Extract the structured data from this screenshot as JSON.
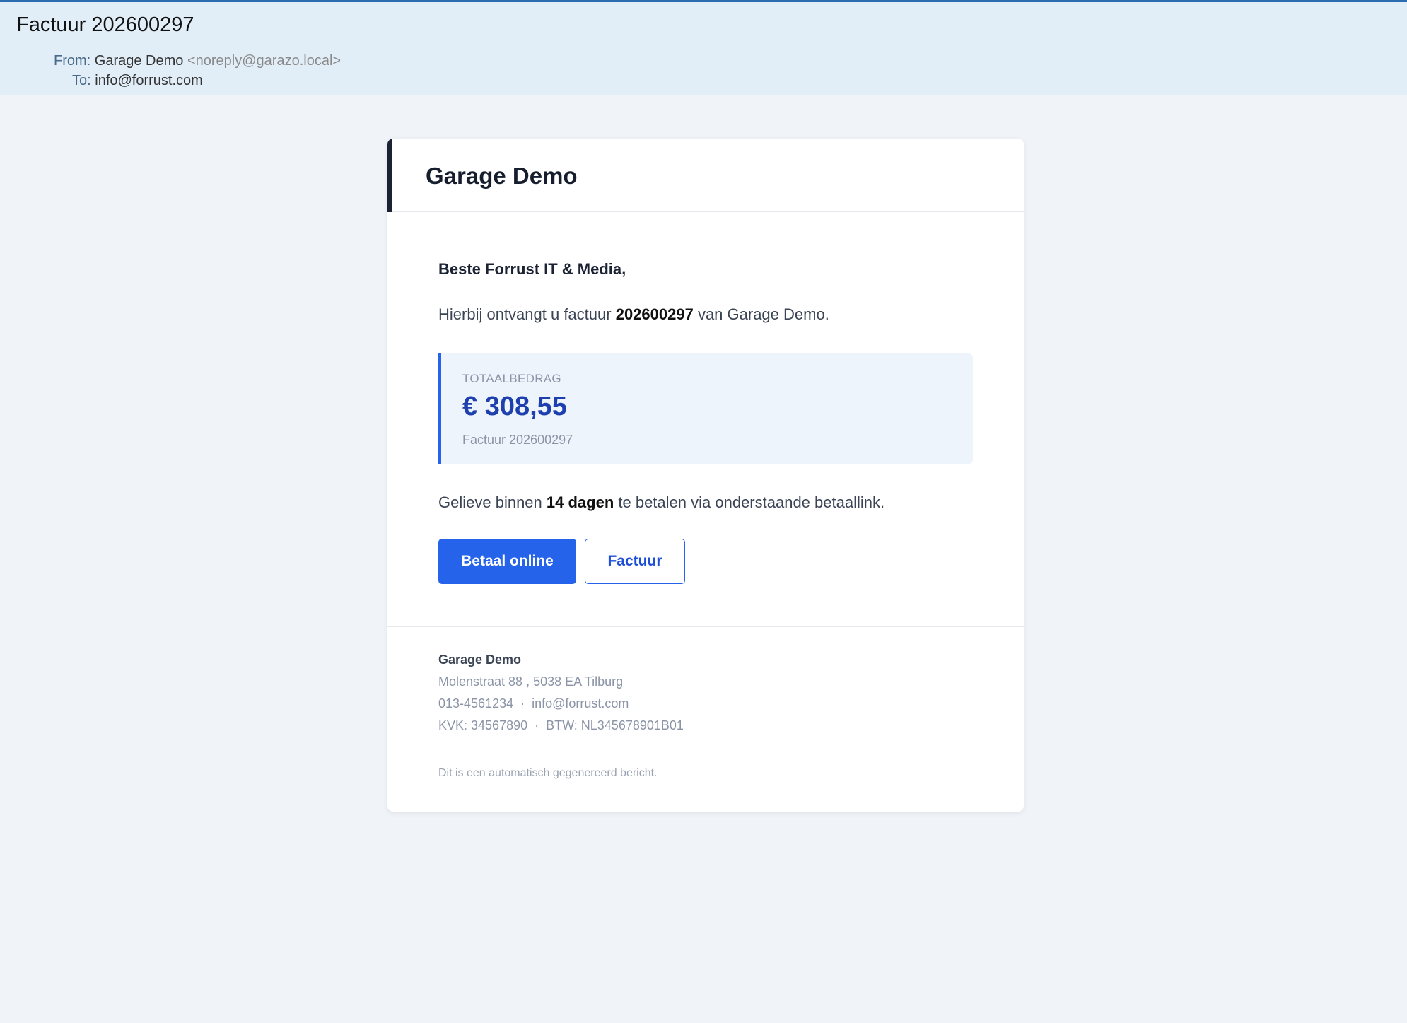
{
  "mail": {
    "subject": "Factuur 202600297",
    "from_label": "From:",
    "from_name": "Garage Demo",
    "from_email": "<noreply@garazo.local>",
    "to_label": "To:",
    "to_value": "info@forrust.com"
  },
  "card": {
    "company": "Garage Demo",
    "greeting": "Beste Forrust IT & Media,",
    "intro_before": "Hierbij ontvangt u factuur ",
    "intro_number": "202600297",
    "intro_after": " van Garage Demo.",
    "total": {
      "label": "TOTAALBEDRAG",
      "amount": "€ 308,55",
      "sub": "Factuur 202600297"
    },
    "pay_before": "Gelieve binnen ",
    "pay_days": "14 dagen",
    "pay_after": " te betalen via onderstaande betaallink.",
    "buttons": {
      "pay": "Betaal online",
      "invoice": "Factuur"
    },
    "footer": {
      "company": "Garage Demo",
      "address": "Molenstraat 88 , 5038 EA Tilburg",
      "contact": "013-4561234  ·  info@forrust.com",
      "registry": "KVK: 34567890  ·  BTW: NL345678901B01",
      "auto_note": "Dit is een automatisch gegenereerd bericht."
    }
  },
  "colors": {
    "accent": "#2563eb",
    "amount": "#1e40af",
    "header_bg": "#e1edf7"
  }
}
